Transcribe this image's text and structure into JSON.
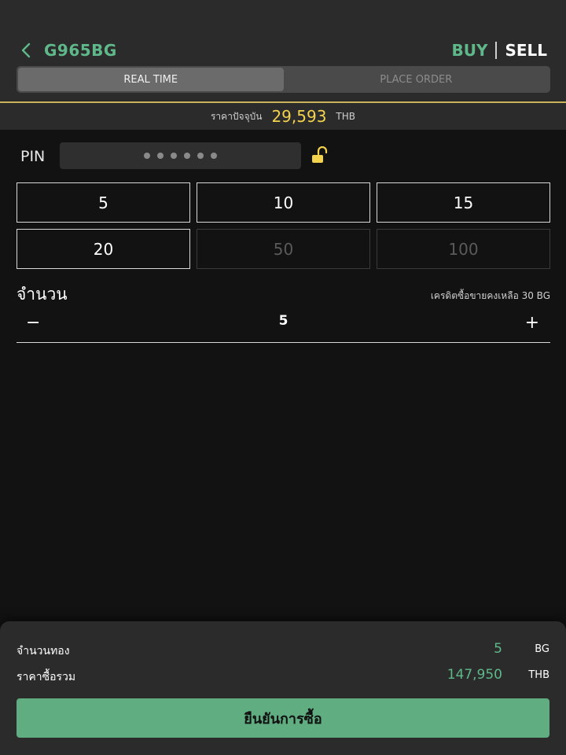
{
  "header": {
    "symbol": "G965BG",
    "buy_label": "BUY",
    "sell_label": "SELL",
    "tabs": [
      {
        "label": "REAL TIME",
        "active": true
      },
      {
        "label": "PLACE ORDER",
        "active": false
      }
    ]
  },
  "price": {
    "label": "ราคาปัจจุบัน",
    "value": "29,593",
    "unit": "THB"
  },
  "pin": {
    "label": "PIN",
    "length": 6
  },
  "quick_amounts": [
    {
      "label": "5",
      "enabled": true
    },
    {
      "label": "10",
      "enabled": true
    },
    {
      "label": "15",
      "enabled": true
    },
    {
      "label": "20",
      "enabled": true
    },
    {
      "label": "50",
      "enabled": false
    },
    {
      "label": "100",
      "enabled": false
    }
  ],
  "amount": {
    "label": "จำนวน",
    "credit_note": "เครดิตซื้อขายคงเหลือ 30 BG",
    "minus": "−",
    "value": "5",
    "plus": "+"
  },
  "summary": {
    "gold_label": "จำนวนทอง",
    "gold_value": "5",
    "gold_unit": "BG",
    "total_label": "ราคาซื้อรวม",
    "total_value": "147,950",
    "total_unit": "THB",
    "confirm_label": "ยืนยันการซื้อ"
  },
  "colors": {
    "accent_green": "#5fb88a",
    "price_gold": "#f3d24e",
    "background": "#121212",
    "panel": "#2b2b2b"
  },
  "icons": {
    "back": "chevron-left-icon",
    "lock": "unlocked-padlock-icon"
  }
}
